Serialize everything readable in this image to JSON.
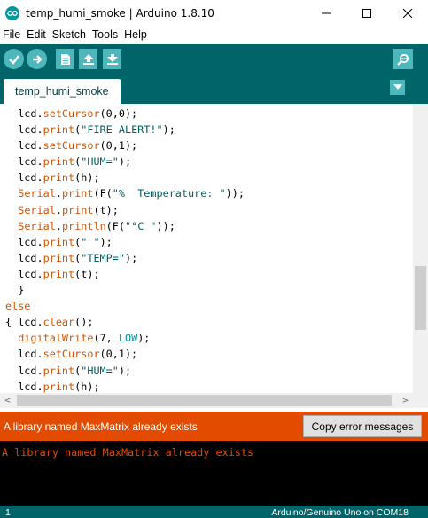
{
  "window": {
    "title": "temp_humi_smoke | Arduino 1.8.10",
    "minimize_glyph": "—",
    "maximize_glyph": "☐",
    "close_glyph": "✕"
  },
  "menu": {
    "items": [
      "File",
      "Edit",
      "Sketch",
      "Tools",
      "Help"
    ]
  },
  "toolbar": {
    "buttons": [
      {
        "name": "verify",
        "icon": "check-icon"
      },
      {
        "name": "upload",
        "icon": "arrow-right-icon"
      },
      {
        "name": "new",
        "icon": "new-file-icon"
      },
      {
        "name": "open",
        "icon": "arrow-up-icon"
      },
      {
        "name": "save",
        "icon": "arrow-down-icon"
      },
      {
        "name": "serial-monitor",
        "icon": "magnifier-icon"
      }
    ]
  },
  "tabs": {
    "active": "temp_humi_smoke",
    "menu_icon": "triangle-down-icon"
  },
  "editor": {
    "lines": [
      [
        {
          "t": "  lcd.",
          "c": "plain"
        },
        {
          "t": "setCursor",
          "c": "kw"
        },
        {
          "t": "(0,0);",
          "c": "plain"
        }
      ],
      [
        {
          "t": "  lcd.",
          "c": "plain"
        },
        {
          "t": "print",
          "c": "kw"
        },
        {
          "t": "(",
          "c": "plain"
        },
        {
          "t": "\"FIRE ALERT!\"",
          "c": "str"
        },
        {
          "t": ");",
          "c": "plain"
        }
      ],
      [
        {
          "t": "  lcd.",
          "c": "plain"
        },
        {
          "t": "setCursor",
          "c": "kw"
        },
        {
          "t": "(0,1);",
          "c": "plain"
        }
      ],
      [
        {
          "t": "  lcd.",
          "c": "plain"
        },
        {
          "t": "print",
          "c": "kw"
        },
        {
          "t": "(",
          "c": "plain"
        },
        {
          "t": "\"HUM=\"",
          "c": "str"
        },
        {
          "t": ");",
          "c": "plain"
        }
      ],
      [
        {
          "t": "  lcd.",
          "c": "plain"
        },
        {
          "t": "print",
          "c": "kw"
        },
        {
          "t": "(h);",
          "c": "plain"
        }
      ],
      [
        {
          "t": "  ",
          "c": "plain"
        },
        {
          "t": "Serial",
          "c": "kw"
        },
        {
          "t": ".",
          "c": "plain"
        },
        {
          "t": "print",
          "c": "kw"
        },
        {
          "t": "(F(",
          "c": "plain"
        },
        {
          "t": "\"%  Temperature: \"",
          "c": "str"
        },
        {
          "t": "));",
          "c": "plain"
        }
      ],
      [
        {
          "t": "  ",
          "c": "plain"
        },
        {
          "t": "Serial",
          "c": "kw"
        },
        {
          "t": ".",
          "c": "plain"
        },
        {
          "t": "print",
          "c": "kw"
        },
        {
          "t": "(t);",
          "c": "plain"
        }
      ],
      [
        {
          "t": "  ",
          "c": "plain"
        },
        {
          "t": "Serial",
          "c": "kw"
        },
        {
          "t": ".",
          "c": "plain"
        },
        {
          "t": "println",
          "c": "kw"
        },
        {
          "t": "(F(",
          "c": "plain"
        },
        {
          "t": "\"°C \"",
          "c": "str"
        },
        {
          "t": "));",
          "c": "plain"
        }
      ],
      [
        {
          "t": "  lcd.",
          "c": "plain"
        },
        {
          "t": "print",
          "c": "kw"
        },
        {
          "t": "(",
          "c": "plain"
        },
        {
          "t": "\" \"",
          "c": "str"
        },
        {
          "t": ");",
          "c": "plain"
        }
      ],
      [
        {
          "t": "  lcd.",
          "c": "plain"
        },
        {
          "t": "print",
          "c": "kw"
        },
        {
          "t": "(",
          "c": "plain"
        },
        {
          "t": "\"TEMP=\"",
          "c": "str"
        },
        {
          "t": ");",
          "c": "plain"
        }
      ],
      [
        {
          "t": "  lcd.",
          "c": "plain"
        },
        {
          "t": "print",
          "c": "kw"
        },
        {
          "t": "(t);",
          "c": "plain"
        }
      ],
      [
        {
          "t": "  }",
          "c": "plain"
        }
      ],
      [
        {
          "t": "else",
          "c": "kw"
        }
      ],
      [
        {
          "t": "{ lcd.",
          "c": "plain"
        },
        {
          "t": "clear",
          "c": "kw"
        },
        {
          "t": "();",
          "c": "plain"
        }
      ],
      [
        {
          "t": "  ",
          "c": "plain"
        },
        {
          "t": "digitalWrite",
          "c": "kw"
        },
        {
          "t": "(7, ",
          "c": "plain"
        },
        {
          "t": "LOW",
          "c": "const"
        },
        {
          "t": ");",
          "c": "plain"
        }
      ],
      [
        {
          "t": "  lcd.",
          "c": "plain"
        },
        {
          "t": "setCursor",
          "c": "kw"
        },
        {
          "t": "(0,1);",
          "c": "plain"
        }
      ],
      [
        {
          "t": "  lcd.",
          "c": "plain"
        },
        {
          "t": "print",
          "c": "kw"
        },
        {
          "t": "(",
          "c": "plain"
        },
        {
          "t": "\"HUM=\"",
          "c": "str"
        },
        {
          "t": ");",
          "c": "plain"
        }
      ],
      [
        {
          "t": "  lcd.",
          "c": "plain"
        },
        {
          "t": "print",
          "c": "kw"
        },
        {
          "t": "(h);",
          "c": "plain"
        }
      ]
    ]
  },
  "scroll": {
    "left_arrow": "<",
    "right_arrow": ">"
  },
  "error": {
    "message": "A library named MaxMatrix already exists",
    "copy_button": "Copy error messages"
  },
  "console": {
    "text": "A library named MaxMatrix already exists"
  },
  "status": {
    "line_number": "1",
    "board": "Arduino/Genuino Uno on COM18"
  },
  "colors": {
    "teal_dark": "#006468",
    "teal_light": "#4db7bb",
    "error_orange": "#e34c00",
    "keyword": "#d35400",
    "string": "#005c5f"
  }
}
